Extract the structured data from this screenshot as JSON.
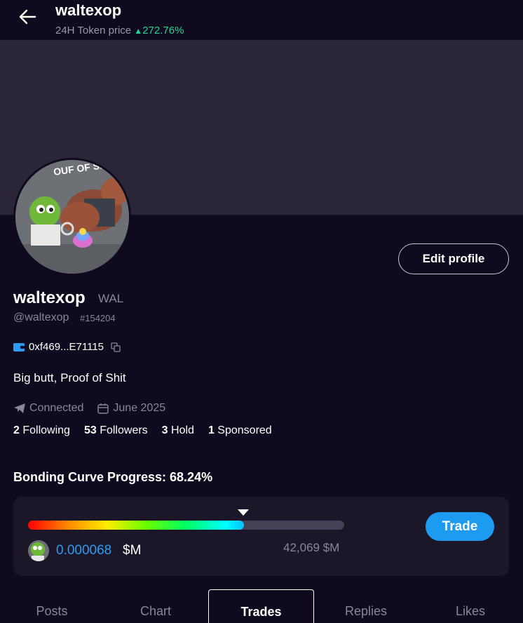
{
  "header": {
    "title": "waltexop",
    "subtitle_label": "24H Token price",
    "change_pct": "272.76%"
  },
  "profile": {
    "name": "waltexop",
    "ticker": "WAL",
    "handle": "@waltexop",
    "id": "#154204",
    "wallet": "0xf469...E71115",
    "bio": "Big butt, Proof of Shit",
    "telegram": "Connected",
    "joined": "June 2025",
    "edit_label": "Edit profile",
    "avatar_text": "OUF OF SHIT"
  },
  "stats": [
    {
      "count": "2",
      "label": "Following"
    },
    {
      "count": "53",
      "label": "Followers"
    },
    {
      "count": "3",
      "label": "Hold"
    },
    {
      "count": "1",
      "label": "Sponsored"
    }
  ],
  "bonding": {
    "title": "Bonding Curve Progress: 68.24%",
    "progress": 0.6824,
    "price": "0.000068",
    "price_unit": "$M",
    "cap": "42,069 $M",
    "trade_label": "Trade"
  },
  "tabs": [
    {
      "label": "Posts",
      "active": false
    },
    {
      "label": "Chart",
      "active": false
    },
    {
      "label": "Trades",
      "active": true
    },
    {
      "label": "Replies",
      "active": false
    },
    {
      "label": "Likes",
      "active": false
    }
  ],
  "colors": {
    "background": "#0f0a1e",
    "banner": "#2b2637",
    "accent": "#1d9bf0",
    "positive": "#22d39a",
    "muted": "#8a8698"
  }
}
